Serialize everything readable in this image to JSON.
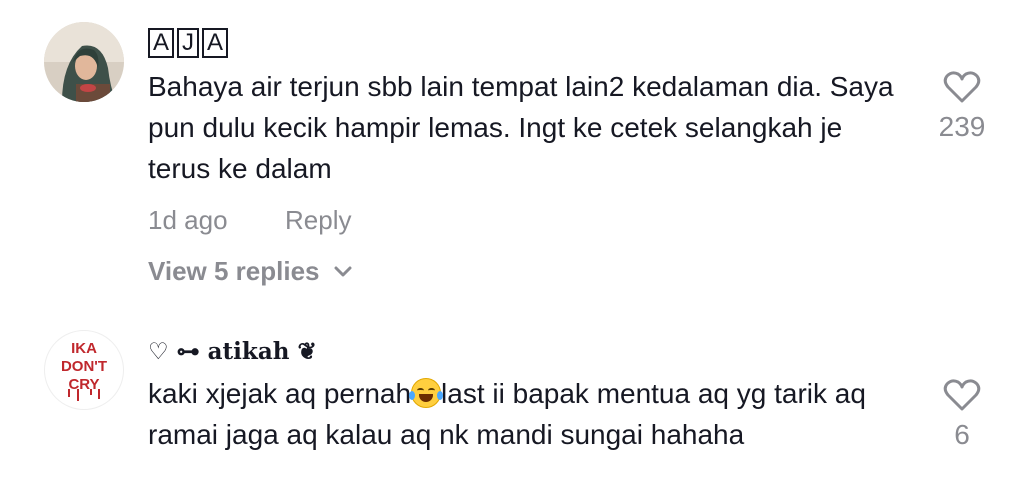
{
  "comments": [
    {
      "username_boxes": [
        "A",
        "J",
        "A"
      ],
      "text": "Bahaya air terjun sbb lain tempat lain2 kedalaman dia. Saya pun dulu kecik hampir lemas. Ingt ke cetek selangkah je terus ke dalam",
      "time": "1d ago",
      "reply_label": "Reply",
      "view_replies": "View 5 replies",
      "like_count": "239",
      "avatar_icon": "woman-hijab-avatar",
      "like_icon": "heart-outline-icon"
    },
    {
      "username": "♡ ⊶ atikah ❦",
      "text_before_emoji": "kaki xjejak aq pernah",
      "emoji": "face-with-tears-of-joy",
      "text_after_emoji": "last ii bapak mentua aq yg tarik aq ramai jaga aq kalau aq nk mandi sungai hahaha",
      "like_count": "6",
      "avatar_text": "IKA DON'T CRY",
      "like_icon": "heart-outline-icon"
    }
  ],
  "colors": {
    "primary_text": "#161823",
    "secondary_text": "#8a8b91",
    "avatar_red": "#c0282d"
  }
}
